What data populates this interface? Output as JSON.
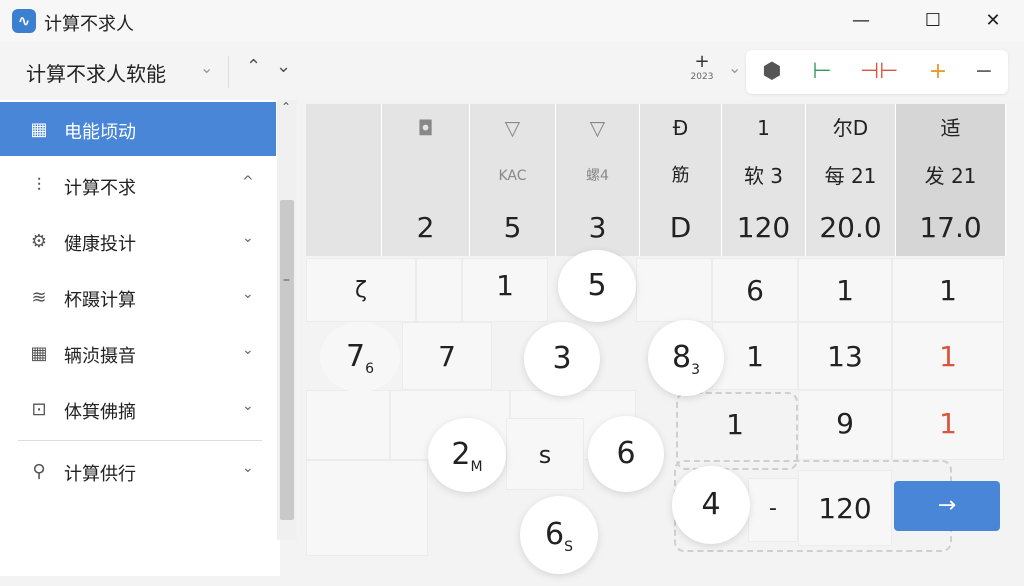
{
  "window": {
    "title": "计算不求人",
    "minimize": "—",
    "maximize": "☐",
    "close": "✕"
  },
  "toolbar": {
    "app_name": "计算不求人软能",
    "tool_a_glyph": "+",
    "tool_a_sub": "2023",
    "tools": [
      "⬢",
      "⊢",
      "⊣⊢",
      "+",
      "−"
    ]
  },
  "sidebar": {
    "items": [
      {
        "label": "电能顷动",
        "icon": "▦",
        "chevron": ""
      },
      {
        "label": "计算不求",
        "icon": "⫶",
        "chevron": "^"
      },
      {
        "label": "健康投计",
        "icon": "⚙",
        "chevron": "⌄"
      },
      {
        "label": "杯蹑计算",
        "icon": "≋",
        "chevron": "⌄"
      },
      {
        "label": "辆浈摄音",
        "icon": "▦",
        "chevron": "⌄"
      },
      {
        "label": "体箕佛摘",
        "icon": "⊡",
        "chevron": "⌄"
      },
      {
        "label": "计算供行",
        "icon": "⚲",
        "chevron": "⌄"
      }
    ]
  },
  "grid": {
    "header_row1": [
      "",
      "◘",
      "▽",
      "▽",
      "Ð",
      "1",
      "尔D",
      "适"
    ],
    "header_row2": [
      "",
      "",
      "KAC",
      "螺4",
      "筋",
      "软 3",
      "每 21",
      "发 21"
    ],
    "header_row3": [
      "",
      "2",
      "5",
      "3",
      "D",
      "120",
      "20.0",
      "17.0"
    ],
    "row1": [
      "ζ",
      "1",
      "",
      "6",
      "1",
      "1"
    ],
    "row2": [
      "7",
      "7",
      "1",
      "13",
      "1"
    ],
    "row3": [
      "1",
      "9",
      "1"
    ],
    "row4_s": "s",
    "row4_dash": "-",
    "row4_val": "120",
    "bubbles": {
      "b5": "5",
      "b3": "3",
      "b8": "8",
      "b8sub": "3",
      "b7": "7",
      "b7sub": "6",
      "b2": "2",
      "b2sub": "M",
      "b6": "6",
      "b4": "4",
      "b6s": "6",
      "b6ssub": "S"
    },
    "go_arrow": "→"
  }
}
